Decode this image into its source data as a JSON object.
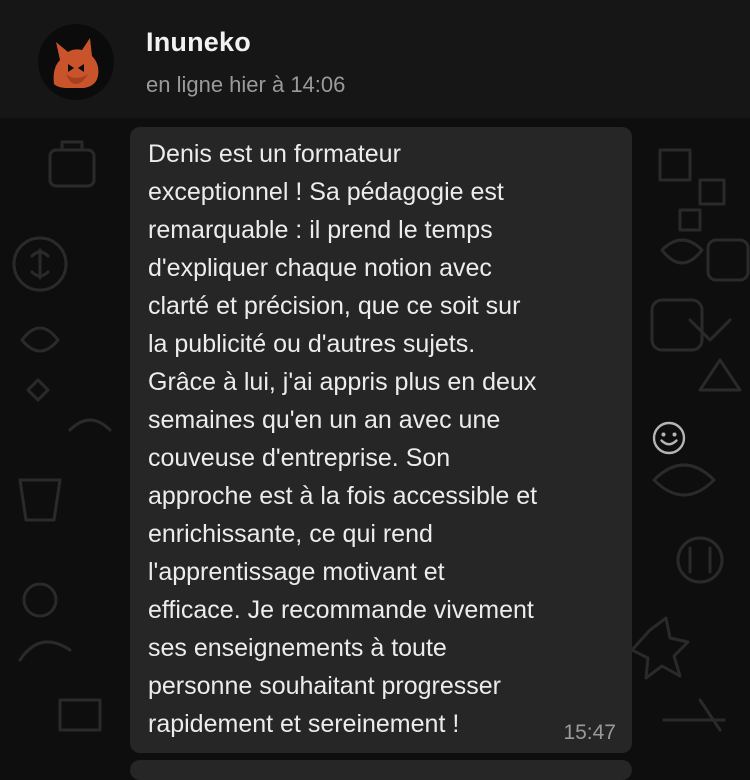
{
  "contact": {
    "name": "Inuneko",
    "status": "en ligne hier à 14:06",
    "avatar_icon": "fox-avatar-icon"
  },
  "message": {
    "text": "Denis est un formateur\nexceptionnel ! Sa pédagogie est\nremarquable : il prend le temps\nd'expliquer chaque notion avec\nclarté et précision, que ce soit sur\nla publicité ou d'autres sujets.\nGrâce à lui, j'ai appris plus en deux\nsemaines qu'en un an avec une\ncouveuse d'entreprise. Son\napproche est à la fois accessible et\nenrichissante, ce qui rend\nl'apprentissage motivant et\nefficace. Je recommande vivement\nses enseignements à toute\npersonne souhaitant progresser\nrapidement et sereinement !",
    "time": "15:47"
  },
  "reaction": {
    "icon": "emoji-reaction-icon"
  },
  "colors": {
    "background": "#0e0e0e",
    "bubble": "#262626",
    "avatar_fill": "#c9532a",
    "text": "#ececec",
    "muted": "#9a9a9a"
  }
}
